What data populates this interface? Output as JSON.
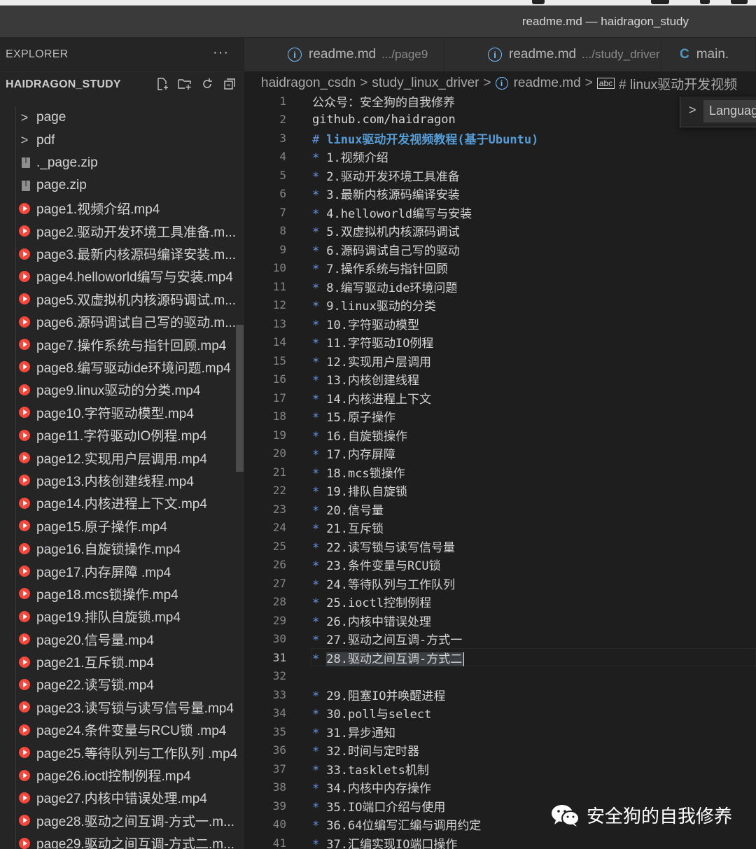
{
  "window": {
    "title": "readme.md — haidragon_study"
  },
  "sidebar": {
    "header": "EXPLORER",
    "more": "···",
    "project": "HAIDRAGON_STUDY",
    "items": [
      {
        "type": "folder",
        "label": "page"
      },
      {
        "type": "folder",
        "label": "pdf"
      },
      {
        "type": "zip",
        "label": "._page.zip"
      },
      {
        "type": "zip",
        "label": "page.zip"
      },
      {
        "type": "mp4",
        "label": "page1.视频介绍.mp4"
      },
      {
        "type": "mp4",
        "label": "page2.驱动开发环境工具准备.m..."
      },
      {
        "type": "mp4",
        "label": "page3.最新内核源码编译安装.m..."
      },
      {
        "type": "mp4",
        "label": "page4.helloworld编写与安装.mp4"
      },
      {
        "type": "mp4",
        "label": "page5.双虚拟机内核源码调试.m..."
      },
      {
        "type": "mp4",
        "label": "page6.源码调试自己写的驱动.m..."
      },
      {
        "type": "mp4",
        "label": "page7.操作系统与指针回顾.mp4"
      },
      {
        "type": "mp4",
        "label": "page8.编写驱动ide环境问题.mp4"
      },
      {
        "type": "mp4",
        "label": "page9.linux驱动的分类.mp4"
      },
      {
        "type": "mp4",
        "label": "page10.字符驱动模型.mp4"
      },
      {
        "type": "mp4",
        "label": "page11.字符驱动IO例程.mp4"
      },
      {
        "type": "mp4",
        "label": "page12.实现用户层调用.mp4"
      },
      {
        "type": "mp4",
        "label": "page13.内核创建线程.mp4"
      },
      {
        "type": "mp4",
        "label": "page14.内核进程上下文.mp4"
      },
      {
        "type": "mp4",
        "label": "page15.原子操作.mp4"
      },
      {
        "type": "mp4",
        "label": "page16.自旋锁操作.mp4"
      },
      {
        "type": "mp4",
        "label": "page17.内存屏障 .mp4"
      },
      {
        "type": "mp4",
        "label": "page18.mcs锁操作.mp4"
      },
      {
        "type": "mp4",
        "label": "page19.排队自旋锁.mp4"
      },
      {
        "type": "mp4",
        "label": "page20.信号量.mp4"
      },
      {
        "type": "mp4",
        "label": "page21.互斥锁.mp4"
      },
      {
        "type": "mp4",
        "label": "page22.读写锁.mp4"
      },
      {
        "type": "mp4",
        "label": "page23.读写锁与读写信号量.mp4"
      },
      {
        "type": "mp4",
        "label": "page24.条件变量与RCU锁 .mp4"
      },
      {
        "type": "mp4",
        "label": "page25.等待队列与工作队列 .mp4"
      },
      {
        "type": "mp4",
        "label": "page26.ioctl控制例程.mp4"
      },
      {
        "type": "mp4",
        "label": "page27.内核中错误处理.mp4"
      },
      {
        "type": "mp4",
        "label": "page28.驱动之间互调-方式一.m..."
      },
      {
        "type": "mp4",
        "label": "page29.驱动之间互调-方式二.m..."
      }
    ]
  },
  "tabs": [
    {
      "label": "readme.md",
      "desc": ".../page9",
      "icon": "i"
    },
    {
      "label": "readme.md",
      "desc": ".../study_driver",
      "icon": "i"
    },
    {
      "label": "main.",
      "desc": "",
      "icon": "C"
    }
  ],
  "breadcrumb": {
    "parts": [
      "haidragon_csdn",
      "study_linux_driver",
      "readme.md"
    ],
    "symbol_icon": "abc",
    "symbol": "# linux驱动开发视频"
  },
  "widget": {
    "input_value": "Languag"
  },
  "editor": {
    "current_line": 31,
    "lines": [
      {
        "n": "1",
        "bullet": "",
        "text": "公众号：安全狗的自我修养",
        "heading": false
      },
      {
        "n": "2",
        "bullet": "",
        "text": "github.com/haidragon",
        "heading": false
      },
      {
        "n": "3",
        "bullet": "#",
        "text": "linux驱动开发视频教程(基于Ubuntu)",
        "heading": true
      },
      {
        "n": "4",
        "bullet": "*",
        "text": "1.视频介绍",
        "heading": false
      },
      {
        "n": "5",
        "bullet": "*",
        "text": "2.驱动开发环境工具准备",
        "heading": false
      },
      {
        "n": "6",
        "bullet": "*",
        "text": "3.最新内核源码编译安装",
        "heading": false
      },
      {
        "n": "7",
        "bullet": "*",
        "text": "4.helloworld编写与安装",
        "heading": false
      },
      {
        "n": "8",
        "bullet": "*",
        "text": "5.双虚拟机内核源码调试",
        "heading": false
      },
      {
        "n": "9",
        "bullet": "*",
        "text": "6.源码调试自己写的驱动",
        "heading": false
      },
      {
        "n": "10",
        "bullet": "*",
        "text": "7.操作系统与指针回顾",
        "heading": false
      },
      {
        "n": "11",
        "bullet": "*",
        "text": "8.编写驱动ide环境问题",
        "heading": false
      },
      {
        "n": "12",
        "bullet": "*",
        "text": "9.linux驱动的分类",
        "heading": false
      },
      {
        "n": "13",
        "bullet": "*",
        "text": "10.字符驱动模型",
        "heading": false
      },
      {
        "n": "14",
        "bullet": "*",
        "text": "11.字符驱动IO例程",
        "heading": false
      },
      {
        "n": "15",
        "bullet": "*",
        "text": "12.实现用户层调用",
        "heading": false
      },
      {
        "n": "16",
        "bullet": "*",
        "text": "13.内核创建线程",
        "heading": false
      },
      {
        "n": "17",
        "bullet": "*",
        "text": "14.内核进程上下文",
        "heading": false
      },
      {
        "n": "18",
        "bullet": "*",
        "text": "15.原子操作",
        "heading": false
      },
      {
        "n": "19",
        "bullet": "*",
        "text": "16.自旋锁操作",
        "heading": false
      },
      {
        "n": "20",
        "bullet": "*",
        "text": "17.内存屏障",
        "heading": false
      },
      {
        "n": "21",
        "bullet": "*",
        "text": "18.mcs锁操作",
        "heading": false
      },
      {
        "n": "22",
        "bullet": "*",
        "text": "19.排队自旋锁",
        "heading": false
      },
      {
        "n": "23",
        "bullet": "*",
        "text": "20.信号量",
        "heading": false
      },
      {
        "n": "24",
        "bullet": "*",
        "text": "21.互斥锁",
        "heading": false
      },
      {
        "n": "25",
        "bullet": "*",
        "text": "22.读写锁与读写信号量",
        "heading": false
      },
      {
        "n": "26",
        "bullet": "*",
        "text": "23.条件变量与RCU锁",
        "heading": false
      },
      {
        "n": "27",
        "bullet": "*",
        "text": "24.等待队列与工作队列",
        "heading": false
      },
      {
        "n": "28",
        "bullet": "*",
        "text": "25.ioctl控制例程",
        "heading": false
      },
      {
        "n": "29",
        "bullet": "*",
        "text": "26.内核中错误处理",
        "heading": false
      },
      {
        "n": "30",
        "bullet": "*",
        "text": "27.驱动之间互调-方式一",
        "heading": false
      },
      {
        "n": "31",
        "bullet": "*",
        "text": "28.驱动之间互调-方式二",
        "heading": false
      },
      {
        "n": "32",
        "bullet": "",
        "text": "",
        "heading": false
      },
      {
        "n": "33",
        "bullet": "*",
        "text": "29.阻塞IO并唤醒进程",
        "heading": false
      },
      {
        "n": "34",
        "bullet": "*",
        "text": "30.poll与select",
        "heading": false
      },
      {
        "n": "35",
        "bullet": "*",
        "text": "31.异步通知",
        "heading": false
      },
      {
        "n": "36",
        "bullet": "*",
        "text": "32.时间与定时器",
        "heading": false
      },
      {
        "n": "37",
        "bullet": "*",
        "text": "33.tasklets机制",
        "heading": false
      },
      {
        "n": "38",
        "bullet": "*",
        "text": "34.内核中内存操作",
        "heading": false
      },
      {
        "n": "39",
        "bullet": "*",
        "text": "35.IO端口介绍与使用",
        "heading": false
      },
      {
        "n": "40",
        "bullet": "*",
        "text": "36.64位编写汇编与调用约定",
        "heading": false
      },
      {
        "n": "41",
        "bullet": "*",
        "text": "37.汇编实现IO端口操作",
        "heading": false
      }
    ]
  },
  "watermark": {
    "text": "安全狗的自我修养",
    "icon": "wechat-icon"
  }
}
